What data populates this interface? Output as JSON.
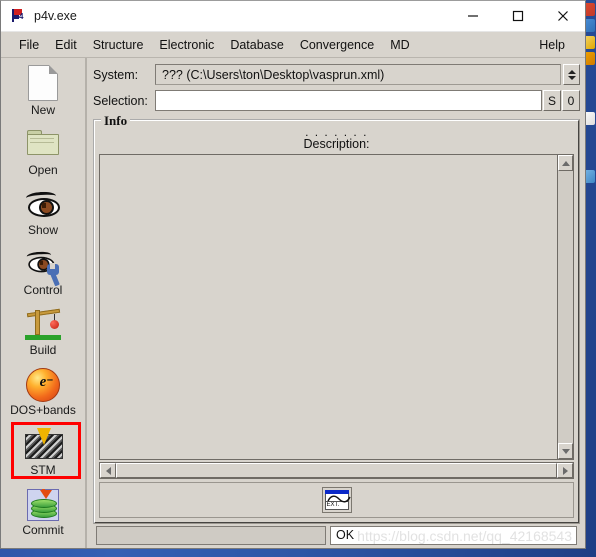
{
  "window": {
    "title": "p4v.exe",
    "app_icon": "p4-flag-icon",
    "controls": {
      "minimize": "minimize-icon",
      "maximize": "maximize-icon",
      "close": "close-icon"
    }
  },
  "menubar": {
    "items": [
      {
        "label": "File"
      },
      {
        "label": "Edit"
      },
      {
        "label": "Structure"
      },
      {
        "label": "Electronic"
      },
      {
        "label": "Database"
      },
      {
        "label": "Convergence"
      },
      {
        "label": "MD"
      }
    ],
    "right_items": [
      {
        "label": "Help"
      }
    ]
  },
  "sidebar": {
    "items": [
      {
        "label": "New",
        "icon": "new-page-icon"
      },
      {
        "label": "Open",
        "icon": "open-folder-icon"
      },
      {
        "label": "Show",
        "icon": "eye-icon"
      },
      {
        "label": "Control",
        "icon": "eye-wrench-icon"
      },
      {
        "label": "Build",
        "icon": "crane-icon"
      },
      {
        "label": "DOS+bands",
        "icon": "electron-icon",
        "highlighted": true
      },
      {
        "label": "STM",
        "icon": "stm-tip-icon"
      },
      {
        "label": "Commit",
        "icon": "commit-disks-icon"
      }
    ],
    "highlight_color": "#ff0000"
  },
  "main": {
    "system": {
      "label": "System:",
      "value": "??? (C:\\Users\\ton\\Desktop\\vasprun.xml)",
      "spinner": "spinner-updown-icon"
    },
    "selection": {
      "label": "Selection:",
      "value": "",
      "placeholder": "",
      "button_s": "S",
      "button_0": "0"
    },
    "info": {
      "group_title": "Info",
      "dots": ". . . . . . .",
      "description_label": "Description:",
      "description_text": ""
    },
    "ext_button": {
      "label": "EXT.",
      "icon": "ext-wave-icon"
    }
  },
  "statusbar": {
    "left_text": "",
    "message": "OK",
    "watermark": "https://blog.csdn.net/qq_42168543"
  }
}
